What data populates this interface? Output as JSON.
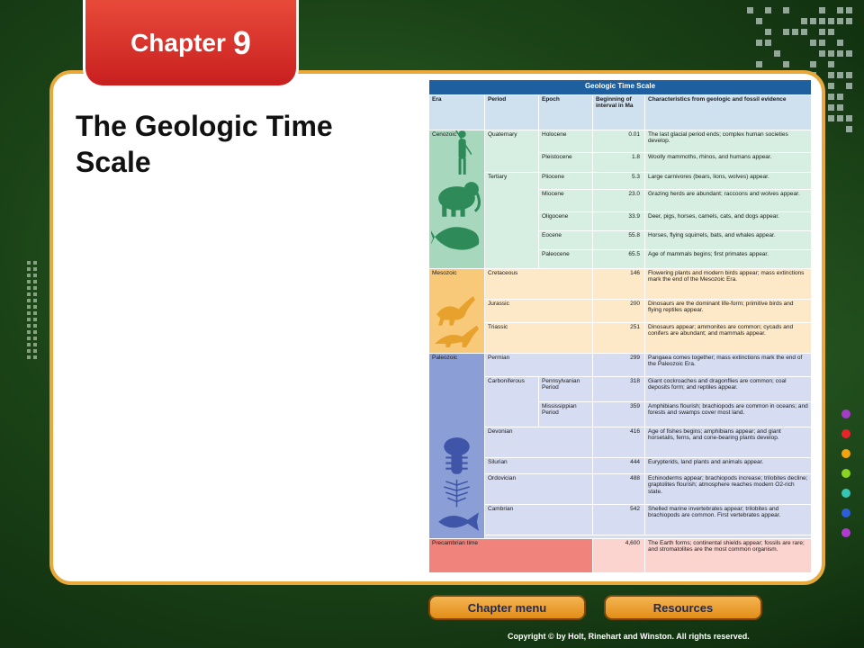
{
  "chapter_tab": {
    "word": "Chapter",
    "number": "9"
  },
  "slide": {
    "title": "The Geologic Time Scale"
  },
  "table": {
    "title": "Geologic Time Scale",
    "headers": [
      "Era",
      "Period",
      "Epoch",
      "Beginning of interval in Ma",
      "Characteristics from geologic and fossil evidence"
    ],
    "eras": {
      "cenozoic": "Cenozoic",
      "mesozoic": "Mesozoic",
      "paleozoic": "Paleozoic",
      "precambrian": "Precambrian time"
    },
    "periods": {
      "quaternary": "Quaternary",
      "tertiary": "Tertiary",
      "cretaceous": "Cretaceous",
      "jurassic": "Jurassic",
      "triassic": "Triassic",
      "permian": "Permian",
      "carboniferous": "Carboniferous",
      "devonian": "Devonian",
      "silurian": "Silurian",
      "ordovician": "Ordovician",
      "cambrian": "Cambrian"
    },
    "rows": [
      {
        "epoch": "Holocene",
        "ma": "0.01",
        "desc": "The last glacial period ends; complex human societies develop."
      },
      {
        "epoch": "Pleistocene",
        "ma": "1.8",
        "desc": "Woolly mammoths, rhinos, and humans appear."
      },
      {
        "epoch": "Pliocene",
        "ma": "5.3",
        "desc": "Large carnivores (bears, lions, wolves) appear."
      },
      {
        "epoch": "Miocene",
        "ma": "23.0",
        "desc": "Grazing herds are abundant; raccoons and wolves appear."
      },
      {
        "epoch": "Oligocene",
        "ma": "33.9",
        "desc": "Deer, pigs, horses, camels, cats, and dogs appear."
      },
      {
        "epoch": "Eocene",
        "ma": "55.8",
        "desc": "Horses, flying squirrels, bats, and whales appear."
      },
      {
        "epoch": "Paleocene",
        "ma": "65.5",
        "desc": "Age of mammals begins; first primates appear."
      },
      {
        "epoch": "",
        "ma": "146",
        "desc": "Flowering plants and modern birds appear; mass extinctions mark the end of the Mesozoic Era."
      },
      {
        "epoch": "",
        "ma": "200",
        "desc": "Dinosaurs are the dominant life-form; primitive birds and flying reptiles appear."
      },
      {
        "epoch": "",
        "ma": "251",
        "desc": "Dinosaurs appear; ammonites are common; cycads and conifers are abundant; and mammals appear."
      },
      {
        "epoch": "",
        "ma": "299",
        "desc": "Pangaea comes together; mass extinctions mark the end of the Paleozoic Era."
      },
      {
        "epoch": "Pennsylvanian Period",
        "ma": "318",
        "desc": "Giant cockroaches and dragonflies are common; coal deposits form; and reptiles appear."
      },
      {
        "epoch": "Mississippian Period",
        "ma": "359",
        "desc": "Amphibians flourish; brachiopods are common in oceans; and forests and swamps cover most land."
      },
      {
        "epoch": "",
        "ma": "416",
        "desc": "Age of fishes begins; amphibians appear; and giant horsetails, ferns, and cone-bearing plants develop."
      },
      {
        "epoch": "",
        "ma": "444",
        "desc": "Eurypterids, land plants and animals appear."
      },
      {
        "epoch": "",
        "ma": "488",
        "desc": "Echinoderms appear; brachiopods increase; trilobites decline; graptolites flourish; atmosphere reaches modern O2-rich state."
      },
      {
        "epoch": "",
        "ma": "542",
        "desc": "Shelled marine invertebrates appear; trilobites and brachiopods are common. First vertebrates appear."
      },
      {
        "epoch": "",
        "ma": "4,600",
        "desc": "The Earth forms; continental shields appear; fossils are rare; and stromatolites are the most common organism."
      }
    ]
  },
  "buttons": {
    "chapter_menu": "Chapter menu",
    "resources": "Resources"
  },
  "footer": {
    "copyright": "Copyright © by Holt, Rinehart and Winston. All rights reserved."
  },
  "colors": {
    "background": "#1c4418",
    "panel_border": "#e8a93a",
    "chapter_tab": "#d42b22",
    "button": "#eea235",
    "cenozoic": "#a7d8be",
    "mesozoic": "#f9c97a",
    "paleozoic": "#8b9fd6",
    "precambrian": "#f0837b"
  },
  "icons": [
    "human-silhouette-icon",
    "mammoth-icon",
    "whale-icon",
    "dinosaur-icon",
    "trilobite-icon",
    "fern-fossil-icon",
    "fish-icon"
  ],
  "decor": {
    "right_dot_colors": [
      "#a43cc9",
      "#e8232a",
      "#f2a30f",
      "#8ad420",
      "#35c6b4",
      "#2d5fd8",
      "#b23ad0"
    ]
  }
}
